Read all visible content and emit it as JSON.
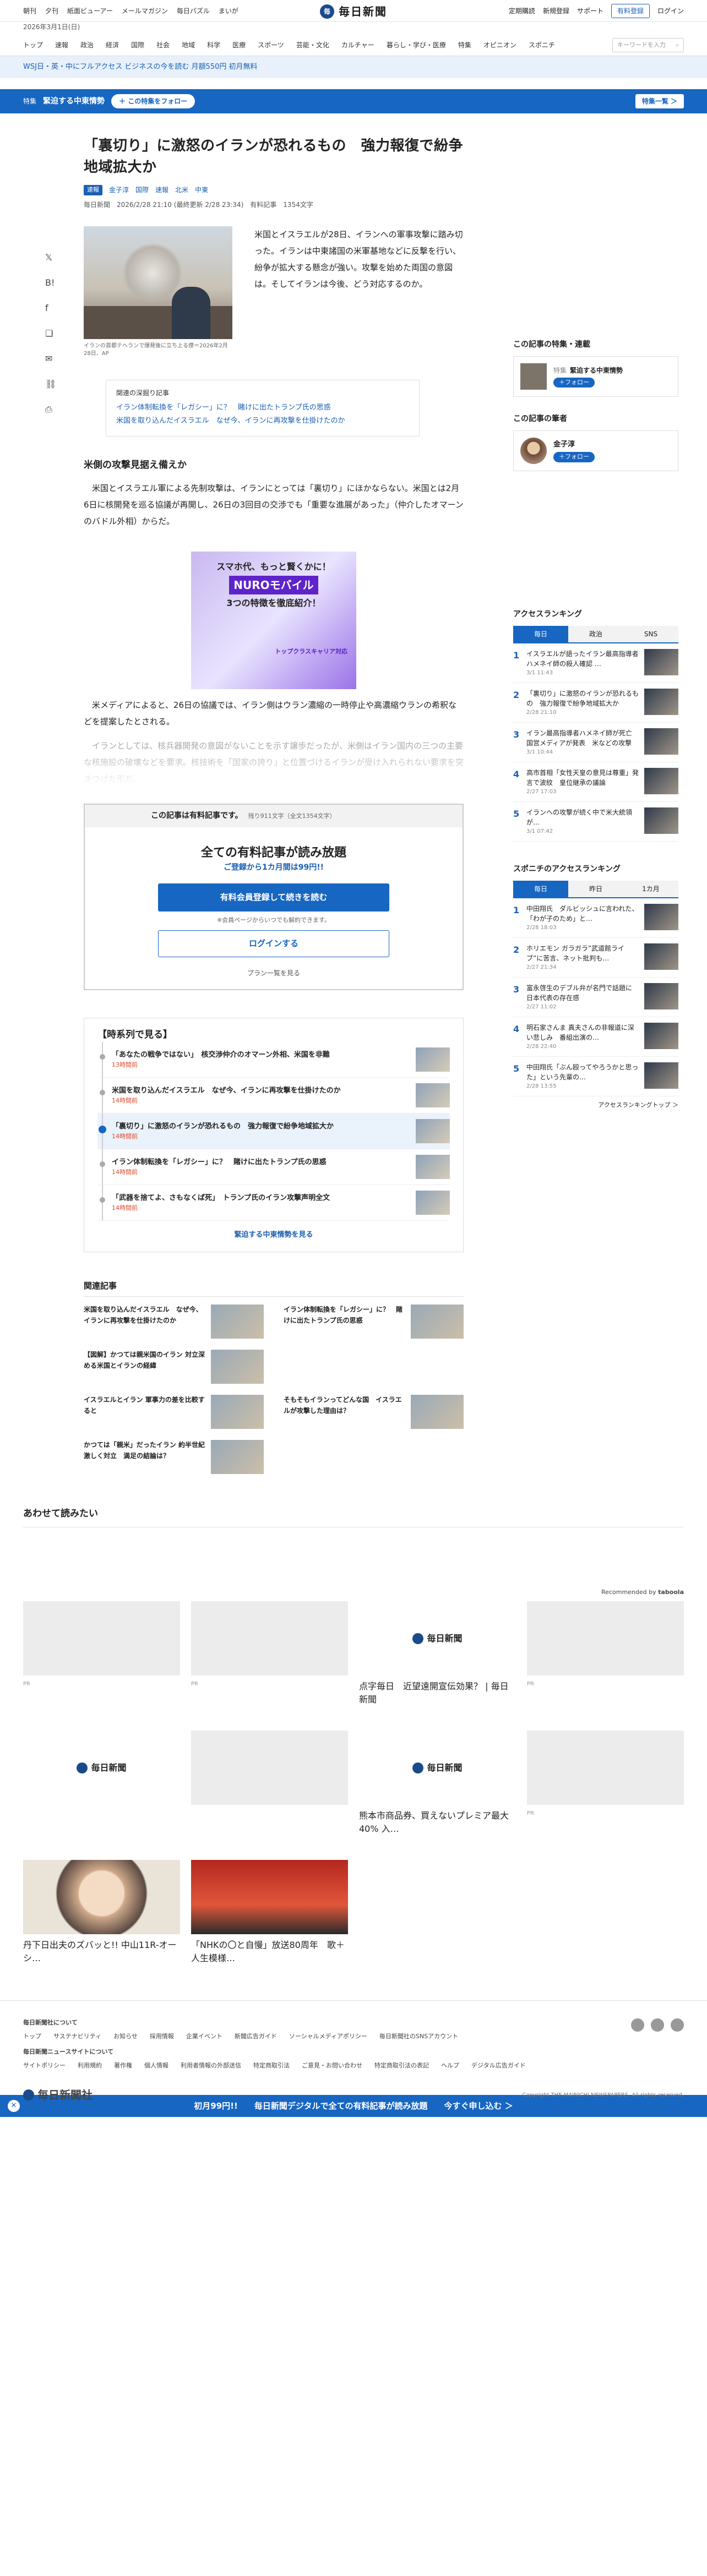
{
  "topbar": {
    "links": [
      "朝刊",
      "夕刊",
      "紙面ビューアー",
      "メールマガジン",
      "毎日パズル",
      "まいが"
    ],
    "logo": "毎日新聞",
    "right": [
      "定期購読",
      "新規登録",
      "サポート"
    ],
    "register": "有料登録",
    "login": "ログイン",
    "date": "2026年3月1日(日)"
  },
  "nav": {
    "items": [
      "トップ",
      "速報",
      "政治",
      "経済",
      "国際",
      "社会",
      "地域",
      "科学",
      "医療",
      "スポーツ",
      "芸能・文化",
      "カルチャー",
      "暮らし・学び・医療",
      "特集",
      "オピニオン",
      "スポニチ"
    ],
    "search_placeholder": "キーワードを入力"
  },
  "promo": {
    "text": "WSJ日・英・中にフルアクセス ビジネスの今を読む 月額550円 初月無料"
  },
  "feature": {
    "tag": "特集",
    "title": "緊迫する中東情勢",
    "follow": "＋ この特集をフォロー",
    "all": "特集一覧 ＞"
  },
  "article": {
    "title": "「裏切り」に激怒のイランが恐れるもの　強力報復で紛争地域拡大か",
    "badge": "速報",
    "author": "金子淳",
    "tags": [
      "国際",
      "速報",
      "北米",
      "中東"
    ],
    "source": "毎日新聞",
    "date": "2026/2/28 21:10 (最終更新 2/28 23:34)",
    "paid": "有料記事",
    "chars": "1354文字",
    "lead": "米国とイスラエルが28日、イランへの軍事攻撃に踏み切った。イランは中東諸国の米軍基地などに反撃を行い、紛争が拡大する懸念が強い。攻撃を始めた両国の意図は。そしてイランは今後、どう対応するのか。",
    "caption": "イランの首都テヘランで爆発後に立ち上る煙＝2026年2月28日、AP",
    "related_head": "関連の深掘り記事",
    "related": [
      "イラン体制転換を「レガシー」に？　賭けに出たトランプ氏の思惑",
      "米国を取り込んだイスラエル　なぜ今、イランに再攻撃を仕掛けたのか"
    ],
    "h2": "米側の攻撃見据え備えか",
    "p1": "米国とイスラエル軍による先制攻撃は、イランにとっては「裏切り」にほかならない。米国とは2月6日に核開発を巡る協議が再開し、26日の3回目の交渉でも「重要な進展があった」（仲介したオマーンのバドル外相）からだ。",
    "p2": "米メディアによると、26日の協議では、イラン側はウラン濃縮の一時停止や高濃縮ウランの希釈などを提案したとされる。",
    "p3": "イランとしては、核兵器開発の意図がないことを示す譲歩だったが、米側はイラン国内の三つの主要な核施設の破壊などを要求。核技術を「国家の誇り」と位置づけるイランが受け入れられない要求を突きつけた形だ。"
  },
  "ad": {
    "l1": "スマホ代、もっと賢くかに！",
    "l2": "NUROモバイル",
    "l3": "3つの特徴を徹底紹介！",
    "l4": "トップクラスキャリア対応"
  },
  "paywall": {
    "head": "この記事は有料記事です。",
    "remain": "残り911文字（全文1354文字）",
    "big": "全ての有料記事が読み放題",
    "sub": "ご登録から1カ月間は99円!!",
    "cta": "有料会員登録して続きを読む",
    "note": "※会員ページからいつでも解約できます。",
    "login": "ログインする",
    "plan": "プラン一覧を見る"
  },
  "timeline": {
    "head": "【時系列で見る】",
    "items": [
      {
        "t": "「あなたの戦争ではない」　核交渉仲介のオマーン外相、米国を非難",
        "d": "13時間前"
      },
      {
        "t": "米国を取り込んだイスラエル　なぜ今、イランに再攻撃を仕掛けたのか",
        "d": "14時間前"
      },
      {
        "t": "「裏切り」に激怒のイランが恐れるもの　強力報復で紛争地域拡大か",
        "d": "14時間前"
      },
      {
        "t": "イラン体制転換を「レガシー」に？　賭けに出たトランプ氏の思惑",
        "d": "14時間前"
      },
      {
        "t": "「武器を捨てよ、さもなくば死」　トランプ氏のイラン攻撃声明全文",
        "d": "14時間前"
      }
    ],
    "more": "緊迫する中東情勢を見る"
  },
  "related2": {
    "head": "関連記事",
    "items": [
      {
        "t": "米国を取り込んだイスラエル　なぜ今、イランに再攻撃を仕掛けたのか"
      },
      {
        "t": "イラン体制転換を「レガシー」に？　賭けに出たトランプ氏の思惑"
      },
      {
        "t": "【図解】かつては親米国のイラン 対立深める米国とイランの経緯"
      },
      {
        "t": ""
      },
      {
        "t": "イスラエルとイラン 軍事力の差を比較すると"
      },
      {
        "t": "そもそもイランってどんな国　イスラエルが攻撃した理由は？"
      },
      {
        "t": "かつては「親米」だったイラン 約半世紀 激しく対立　満足の結論は？"
      },
      {
        "t": ""
      }
    ]
  },
  "sidebar": {
    "feat_head": "この記事の特集・連載",
    "feat_tag": "特集",
    "feat_title": "緊迫する中東情勢",
    "feat_follow": "＋フォロー",
    "writer_head": "この記事の筆者",
    "writer": "金子淳",
    "writer_follow": "＋フォロー",
    "rank_head": "アクセスランキング",
    "rank_tabs": [
      "毎日",
      "政治",
      "SNS"
    ],
    "rank": [
      {
        "t": "イスラエルが語ったイラン最高指導者ハメネイ師の殺人確認 …",
        "dt": "3/1 11:43"
      },
      {
        "t": "「裏切り」に激怒のイランが恐れるもの　強力報復で紛争地域拡大か",
        "dt": "2/28 21:10"
      },
      {
        "t": "イラン最高指導者ハメネイ師が死亡　国営メディアが発表　米などの攻撃",
        "dt": "3/1 10:44"
      },
      {
        "t": "高市首相「女性天皇の意見は尊重」発言で波紋　皇位継承の議論",
        "dt": "2/27 17:03"
      },
      {
        "t": "イランへの攻撃が続く中で米大統領が…",
        "dt": "3/1 07:42"
      }
    ],
    "spo_head": "スポニチのアクセスランキング",
    "spo_tabs": [
      "毎日",
      "昨日",
      "1カ月"
    ],
    "spo": [
      {
        "t": "中田翔氏　ダルビッシュに言われた、「わが子のため」と…",
        "dt": "2/28 18:03"
      },
      {
        "t": "ホリエモン ガラガラ”武道館ライブ”に苦言、ネット批判も…",
        "dt": "2/27 21:34"
      },
      {
        "t": "富永啓生のデブル弁が名門で話題に　日本代表の存在感",
        "dt": "2/27 11:02"
      },
      {
        "t": "明石家さんま 真夫さんの非報道に深い悲しみ　番組出演の…",
        "dt": "2/28 22:40"
      },
      {
        "t": "中田翔氏「ぶん殴ってやろうかと思った」という先輩の…",
        "dt": "2/28 13:55"
      }
    ],
    "rank_more": "アクセスランキングトップ ＞"
  },
  "reco": {
    "head": "あわせて読みたい",
    "by": "Recommended by",
    "cards": [
      {
        "t": "",
        "pr": "PR"
      },
      {
        "t": "",
        "pr": "PR"
      },
      {
        "t": "点字毎日　近望遠開宣伝効果？ | 毎日新聞",
        "pr": ""
      },
      {
        "t": "",
        "pr": "PR"
      },
      {
        "t": "",
        "pr": "PR"
      },
      {
        "t": "",
        "pr": "PR"
      },
      {
        "t": "熊本市商品券、買えないプレミア最大40% 入…",
        "pr": ""
      },
      {
        "t": "",
        "pr": "PR"
      },
      {
        "t": "丹下日出夫のズバッと!! 中山11R-オーシ…",
        "pr": ""
      },
      {
        "t": "「NHKの〇と自慢」放送80周年　歌＋人生模様…",
        "pr": ""
      }
    ]
  },
  "banner": {
    "a": "初月99円!!",
    "b": "毎日新聞デジタルで全ての有料記事が読み放題",
    "c": "今すぐ申し込む ＞"
  },
  "footer": {
    "h1": "毎日新聞社について",
    "links1": [
      "トップ",
      "サステナビリティ",
      "お知らせ",
      "採用情報",
      "企業イベント",
      "新聞広告ガイド",
      "ソーシャルメディアポリシー",
      "毎日新聞社のSNSアカウント"
    ],
    "h2": "毎日新聞ニュースサイトについて",
    "links2": [
      "サイトポリシー",
      "利用規約",
      "著作権",
      "個人情報",
      "利用者情報の外部送信",
      "特定商取引法",
      "ご意見・お問い合わせ",
      "特定商取引法の表記",
      "ヘルプ",
      "デジタル広告ガイド"
    ],
    "logo": "毎日新聞社",
    "copy": "Copyright THE MAINICHI NEWSPAPERS. All rights reserved."
  }
}
